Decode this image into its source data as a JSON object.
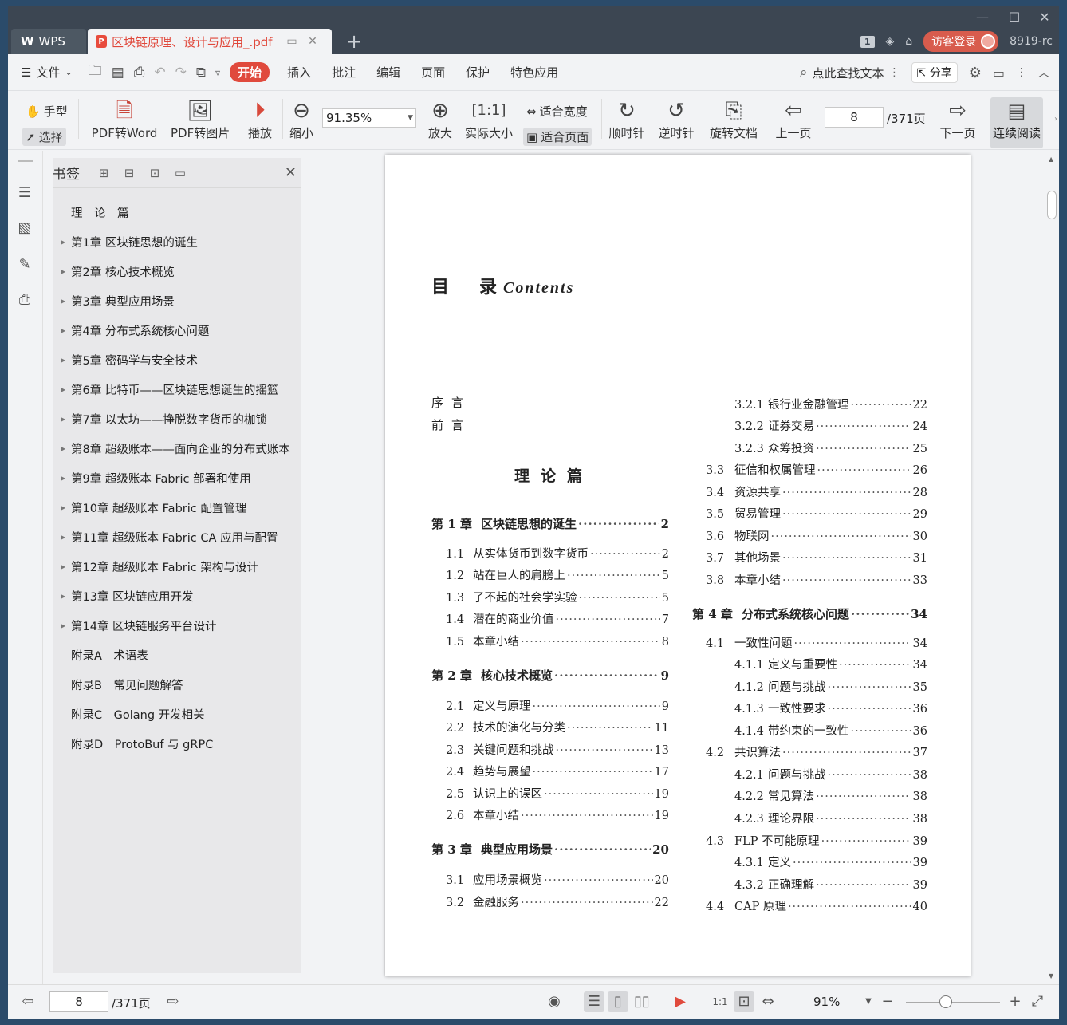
{
  "titlebar": {
    "app_tab": "WPS",
    "doc_tab": "区块链原理、设计与应用_.pdf",
    "page_badge": "1",
    "login": "访客登录",
    "version": "8919-rc"
  },
  "menu": {
    "file": "文件",
    "start": "开始",
    "items": [
      "插入",
      "批注",
      "编辑",
      "页面",
      "保护",
      "特色应用"
    ],
    "search": "点此查找文本",
    "share": "分享"
  },
  "toolbar": {
    "hand": "手型",
    "select": "选择",
    "pdf_word": "PDF转Word",
    "pdf_image": "PDF转图片",
    "play": "播放",
    "zoom_out": "缩小",
    "zoom_value": "91.35%",
    "zoom_in": "放大",
    "actual_size": "实际大小",
    "fit_width": "适合宽度",
    "fit_page": "适合页面",
    "clockwise": "顺时针",
    "counter_clockwise": "逆时针",
    "rotate_doc": "旋转文档",
    "prev_page": "上一页",
    "page_value": "8",
    "page_total": "/371页",
    "next_page": "下一页",
    "continuous": "连续阅读"
  },
  "bookmarks": {
    "title": "书签",
    "items": [
      {
        "label": "理　论　篇",
        "expandable": false
      },
      {
        "label": "第1章 区块链思想的诞生",
        "expandable": true
      },
      {
        "label": "第2章 核心技术概览",
        "expandable": true
      },
      {
        "label": "第3章 典型应用场景",
        "expandable": true
      },
      {
        "label": "第4章 分布式系统核心问题",
        "expandable": true
      },
      {
        "label": "第5章 密码学与安全技术",
        "expandable": true
      },
      {
        "label": "第6章 比特币——区块链思想诞生的摇篮",
        "expandable": true
      },
      {
        "label": "第7章 以太坊——挣脱数字货币的枷锁",
        "expandable": true
      },
      {
        "label": "第8章 超级账本——面向企业的分布式账本",
        "expandable": true
      },
      {
        "label": "第9章 超级账本 Fabric 部署和使用",
        "expandable": true
      },
      {
        "label": "第10章 超级账本 Fabric 配置管理",
        "expandable": true
      },
      {
        "label": "第11章 超级账本 Fabric CA 应用与配置",
        "expandable": true
      },
      {
        "label": "第12章 超级账本 Fabric 架构与设计",
        "expandable": true
      },
      {
        "label": "第13章 区块链应用开发",
        "expandable": true
      },
      {
        "label": "第14章 区块链服务平台设计",
        "expandable": true
      },
      {
        "label": "附录A　术语表",
        "expandable": false
      },
      {
        "label": "附录B　常见问题解答",
        "expandable": false
      },
      {
        "label": "附录C　Golang 开发相关",
        "expandable": false
      },
      {
        "label": "附录D　ProtoBuf 与 gRPC",
        "expandable": false
      }
    ]
  },
  "page": {
    "title_cn_1": "目",
    "title_cn_2": "录",
    "title_en": "Contents",
    "preface": "序言",
    "foreword": "前言",
    "part": "理论篇",
    "left_col": [
      {
        "num": "第 1 章",
        "text": "区块链思想的诞生",
        "page": "2",
        "level": "chapter"
      },
      {
        "num": "1.1",
        "text": "从实体货币到数字货币",
        "page": "2",
        "level": "section"
      },
      {
        "num": "1.2",
        "text": "站在巨人的肩膀上",
        "page": "5",
        "level": "section"
      },
      {
        "num": "1.3",
        "text": "了不起的社会学实验",
        "page": "5",
        "level": "section"
      },
      {
        "num": "1.4",
        "text": "潜在的商业价值",
        "page": "7",
        "level": "section"
      },
      {
        "num": "1.5",
        "text": "本章小结",
        "page": "8",
        "level": "section"
      },
      {
        "num": "第 2 章",
        "text": "核心技术概览",
        "page": "9",
        "level": "chapter"
      },
      {
        "num": "2.1",
        "text": "定义与原理",
        "page": "9",
        "level": "section"
      },
      {
        "num": "2.2",
        "text": "技术的演化与分类",
        "page": "11",
        "level": "section"
      },
      {
        "num": "2.3",
        "text": "关键问题和挑战",
        "page": "13",
        "level": "section"
      },
      {
        "num": "2.4",
        "text": "趋势与展望",
        "page": "17",
        "level": "section"
      },
      {
        "num": "2.5",
        "text": "认识上的误区",
        "page": "19",
        "level": "section"
      },
      {
        "num": "2.6",
        "text": "本章小结",
        "page": "19",
        "level": "section"
      },
      {
        "num": "第 3 章",
        "text": "典型应用场景",
        "page": "20",
        "level": "chapter"
      },
      {
        "num": "3.1",
        "text": "应用场景概览",
        "page": "20",
        "level": "section"
      },
      {
        "num": "3.2",
        "text": "金融服务",
        "page": "22",
        "level": "section"
      }
    ],
    "right_col": [
      {
        "num": "3.2.1",
        "text": "银行业金融管理",
        "page": "22",
        "level": "sub"
      },
      {
        "num": "3.2.2",
        "text": "证券交易",
        "page": "24",
        "level": "sub"
      },
      {
        "num": "3.2.3",
        "text": "众筹投资",
        "page": "25",
        "level": "sub"
      },
      {
        "num": "3.3",
        "text": "征信和权属管理",
        "page": "26",
        "level": "section"
      },
      {
        "num": "3.4",
        "text": "资源共享",
        "page": "28",
        "level": "section"
      },
      {
        "num": "3.5",
        "text": "贸易管理",
        "page": "29",
        "level": "section"
      },
      {
        "num": "3.6",
        "text": "物联网",
        "page": "30",
        "level": "section"
      },
      {
        "num": "3.7",
        "text": "其他场景",
        "page": "31",
        "level": "section"
      },
      {
        "num": "3.8",
        "text": "本章小结",
        "page": "33",
        "level": "section"
      },
      {
        "num": "第 4 章",
        "text": "分布式系统核心问题",
        "page": "34",
        "level": "chapter"
      },
      {
        "num": "4.1",
        "text": "一致性问题",
        "page": "34",
        "level": "section"
      },
      {
        "num": "4.1.1",
        "text": "定义与重要性",
        "page": "34",
        "level": "sub"
      },
      {
        "num": "4.1.2",
        "text": "问题与挑战",
        "page": "35",
        "level": "sub"
      },
      {
        "num": "4.1.3",
        "text": "一致性要求",
        "page": "36",
        "level": "sub"
      },
      {
        "num": "4.1.4",
        "text": "带约束的一致性",
        "page": "36",
        "level": "sub"
      },
      {
        "num": "4.2",
        "text": "共识算法",
        "page": "37",
        "level": "section"
      },
      {
        "num": "4.2.1",
        "text": "问题与挑战",
        "page": "38",
        "level": "sub"
      },
      {
        "num": "4.2.2",
        "text": "常见算法",
        "page": "38",
        "level": "sub"
      },
      {
        "num": "4.2.3",
        "text": "理论界限",
        "page": "38",
        "level": "sub"
      },
      {
        "num": "4.3",
        "text": "FLP 不可能原理",
        "page": "39",
        "level": "section"
      },
      {
        "num": "4.3.1",
        "text": "定义",
        "page": "39",
        "level": "sub"
      },
      {
        "num": "4.3.2",
        "text": "正确理解",
        "page": "39",
        "level": "sub"
      },
      {
        "num": "4.4",
        "text": "CAP 原理",
        "page": "40",
        "level": "section"
      }
    ]
  },
  "status": {
    "page_value": "8",
    "page_total": "/371页",
    "zoom": "91%"
  }
}
